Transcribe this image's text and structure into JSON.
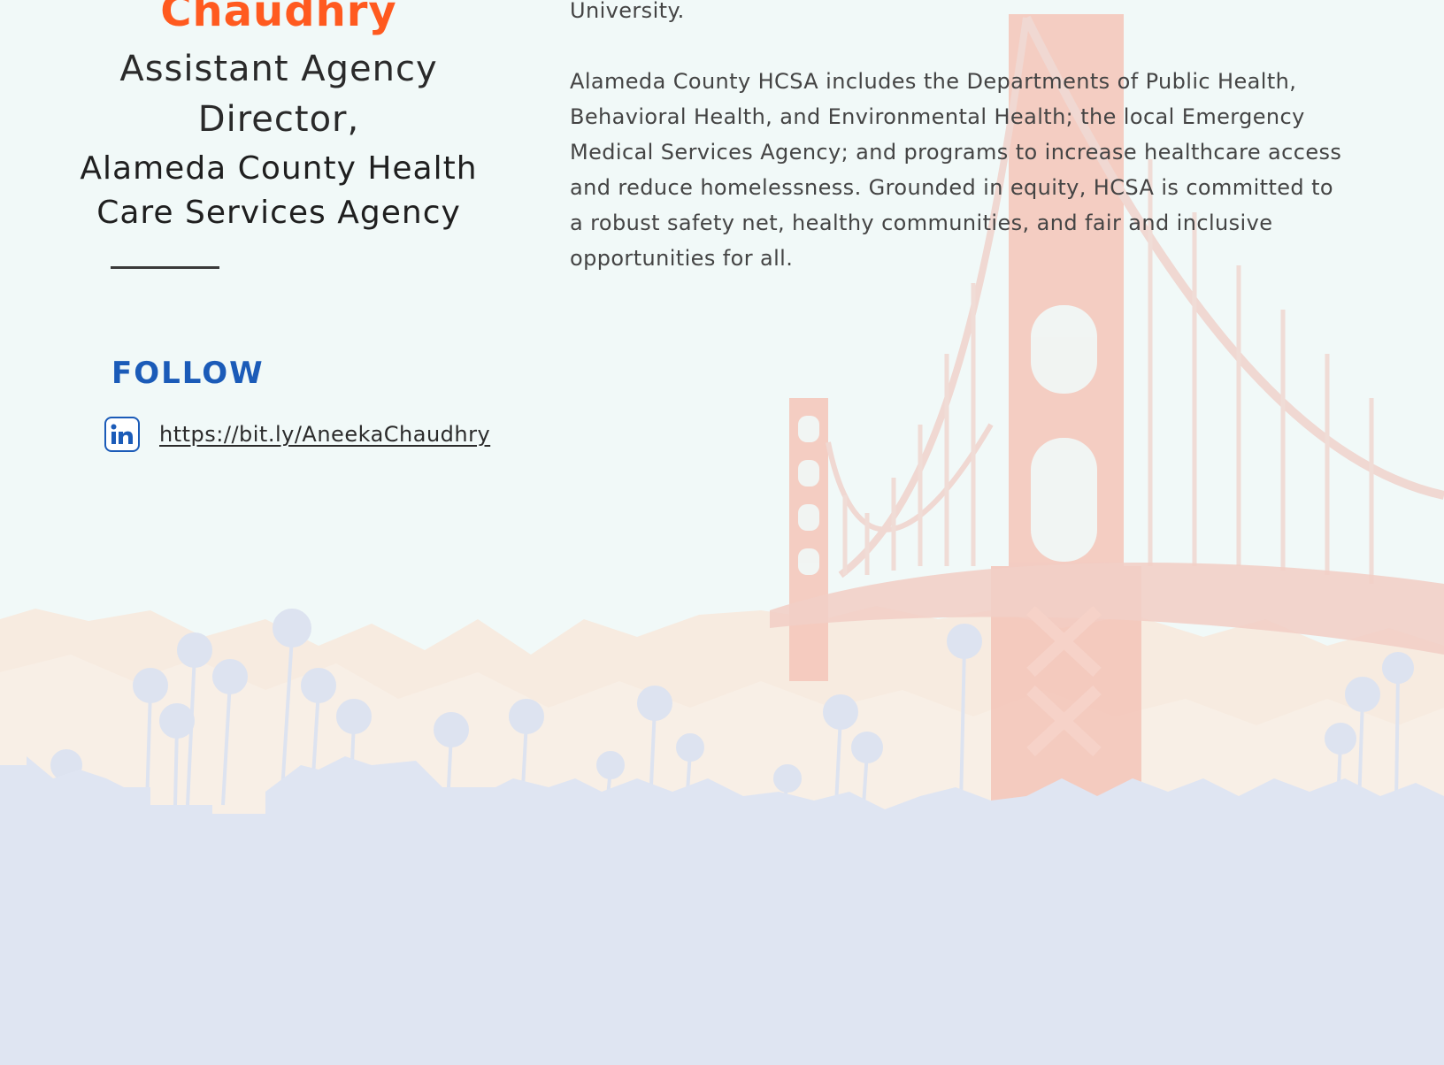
{
  "profile": {
    "name": "Chaudhry",
    "title": "Assistant Agency Director,",
    "organization": "Alameda County Health Care Services Agency"
  },
  "follow": {
    "heading": "FOLLOW",
    "linkedin_icon": "linkedin-icon",
    "linkedin_url": "https://bit.ly/AneekaChaudhry"
  },
  "bio": {
    "fragment": "University.",
    "paragraph": "Alameda County HCSA includes the Departments of Public Health, Behavioral Health, and Environmental Health; the local Emergency Medical Services Agency; and programs to increase healthcare access and reduce homelessness. Grounded in equity, HCSA is committed to a robust safety net, healthy communities, and fair and inclusive opportunities for all."
  },
  "colors": {
    "name_accent": "#ff5a1f",
    "follow_blue": "#1b5bb8",
    "bridge": "#f4b7a6",
    "skyline": "#dfe5f2",
    "background": "#f1f9f8"
  }
}
